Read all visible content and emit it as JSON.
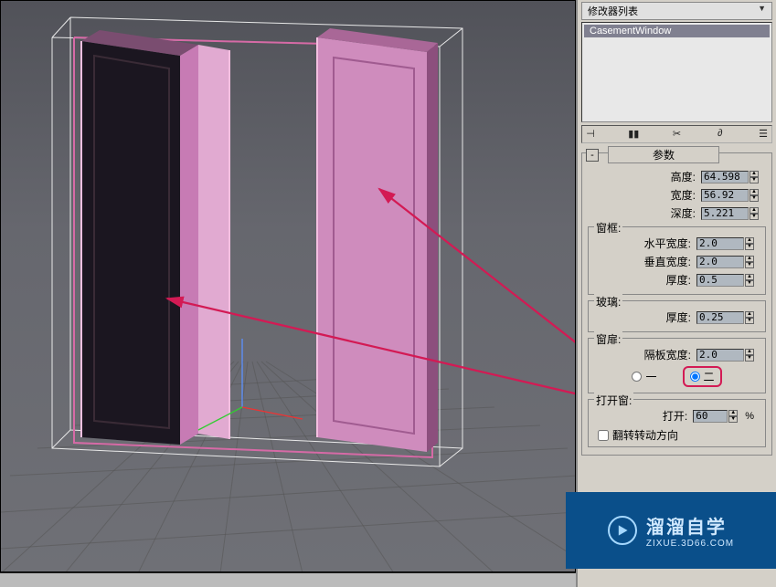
{
  "modifier": {
    "list_label": "修改器列表",
    "stack_item": "CasementWindow"
  },
  "rollout": {
    "minus": "-",
    "title": "参数"
  },
  "dimensions": {
    "height_label": "高度:",
    "height_value": "64.598",
    "width_label": "宽度:",
    "width_value": "56.92",
    "depth_label": "深度:",
    "depth_value": "5.221"
  },
  "frame": {
    "group_title": "窗框:",
    "hwidth_label": "水平宽度:",
    "hwidth_value": "2.0",
    "vwidth_label": "垂直宽度:",
    "vwidth_value": "2.0",
    "thick_label": "厚度:",
    "thick_value": "0.5"
  },
  "glass": {
    "group_title": "玻璃:",
    "thick_label": "厚度:",
    "thick_value": "0.25"
  },
  "casement": {
    "group_title": "窗扉:",
    "panel_label": "隔板宽度:",
    "panel_value": "2.0",
    "radio_one": "一",
    "radio_two": "二"
  },
  "open": {
    "group_title": "打开窗:",
    "open_label": "打开:",
    "open_value": "60",
    "percent": "%",
    "flip_label": "翻转转动方向"
  },
  "watermark": {
    "title": "溜溜自学",
    "sub": "ZIXUE.3D66.COM"
  }
}
